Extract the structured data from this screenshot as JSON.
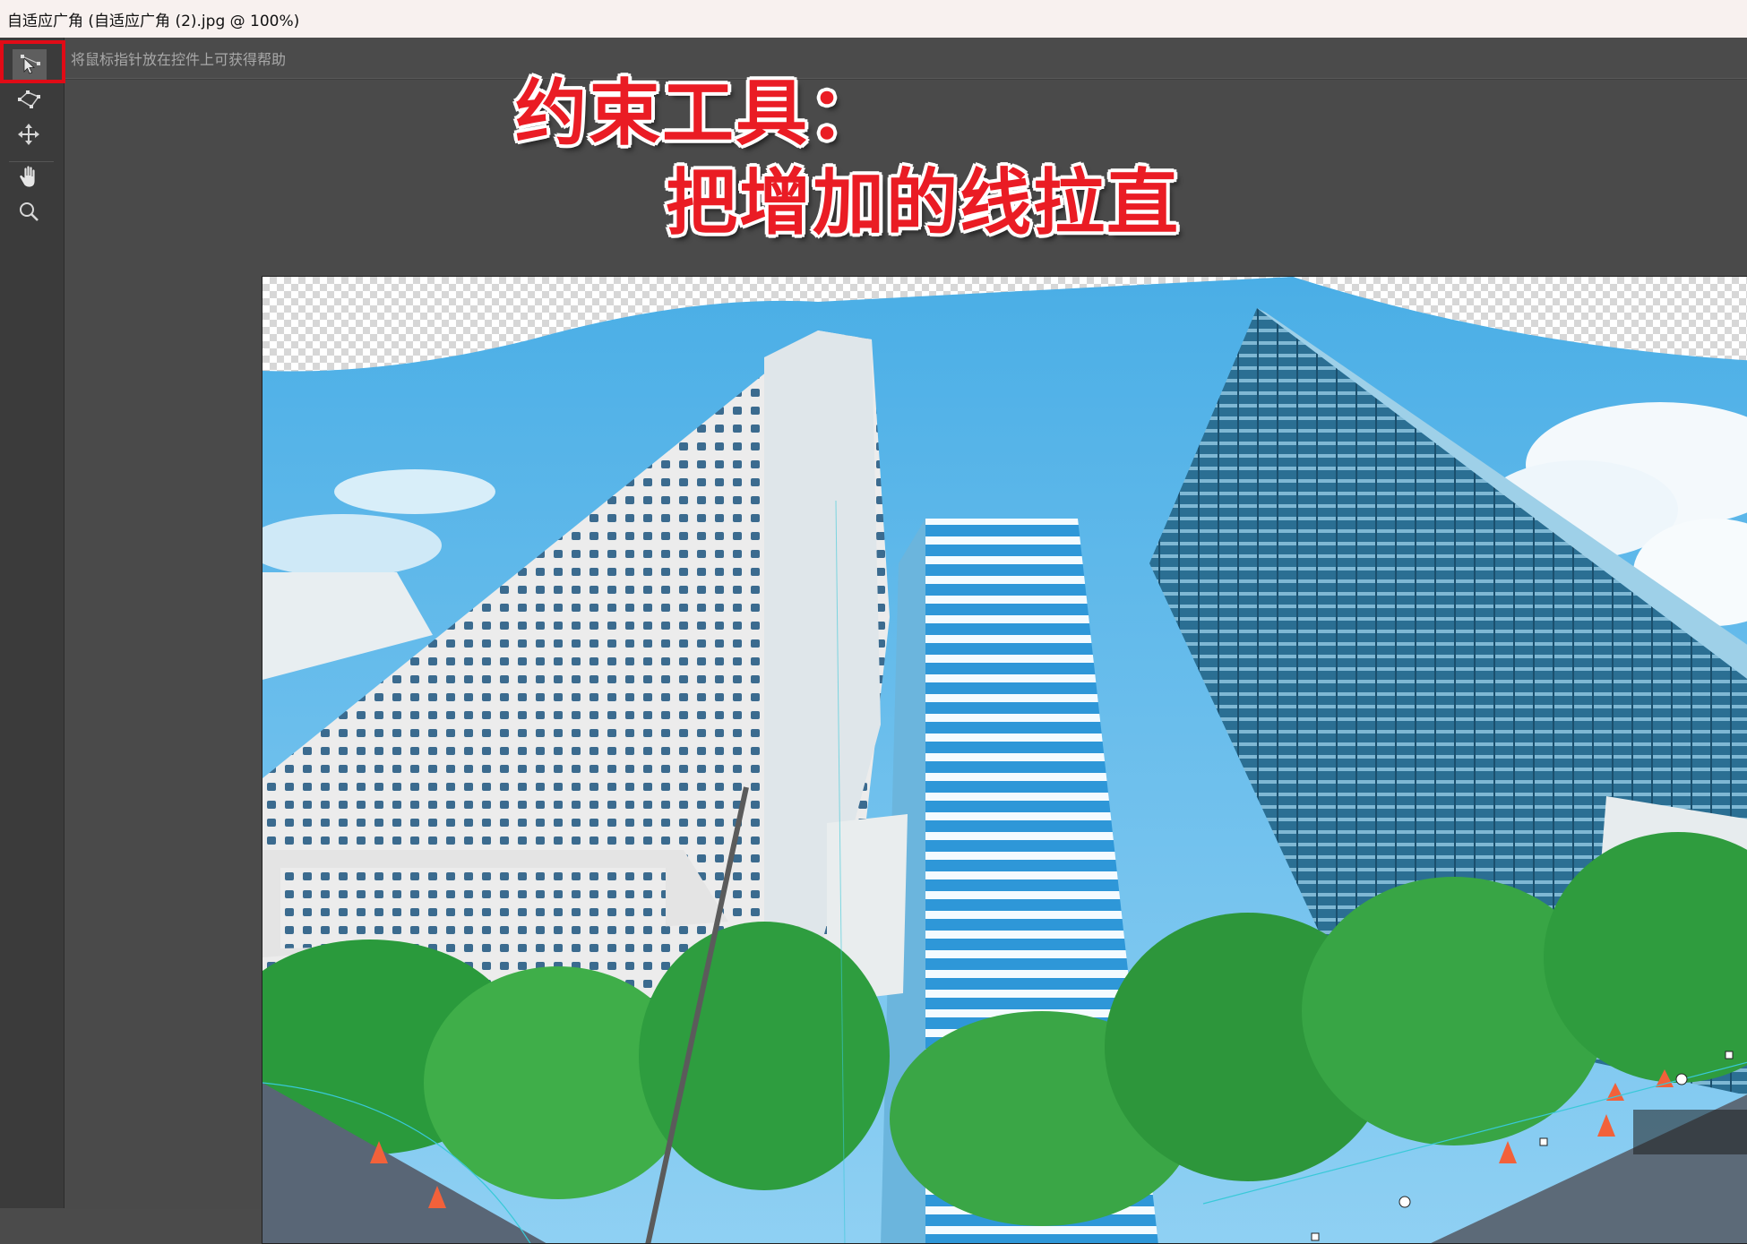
{
  "window": {
    "title": "自适应广角 (自适应广角 (2).jpg @ 100%)"
  },
  "options_bar": {
    "hint": "将鼠标指针放在控件上可获得帮助"
  },
  "tools": [
    {
      "name": "constraint-tool",
      "icon": "constraint-arrow-icon",
      "active": true
    },
    {
      "name": "polygon-constraint-tool",
      "icon": "polygon-constraint-icon"
    },
    {
      "name": "move-tool",
      "icon": "move-arrows-icon"
    },
    {
      "name": "hand-tool",
      "icon": "hand-icon"
    },
    {
      "name": "zoom-tool",
      "icon": "magnifier-icon"
    }
  ],
  "annotations": {
    "line1": "约束工具：",
    "line2": "把增加的线拉直"
  },
  "colors": {
    "annotation_red": "#ea1c24",
    "highlight_frame": "#e10b16",
    "panel_bg": "#4b4b4b"
  }
}
